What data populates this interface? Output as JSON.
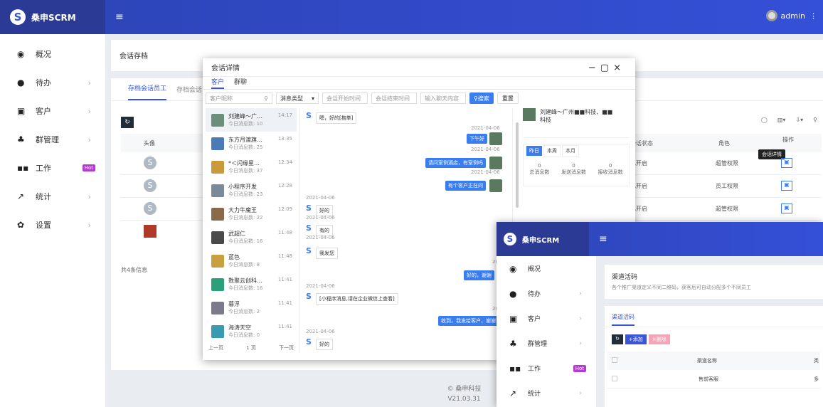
{
  "app": {
    "brand": "桑申SCRM",
    "user": "admin"
  },
  "sidebar": {
    "items": [
      {
        "icon": "dashboard-icon",
        "label": "概况",
        "arrow": ""
      },
      {
        "icon": "clock-icon",
        "label": "待办",
        "arrow": "›"
      },
      {
        "icon": "id-card-icon",
        "label": "客户",
        "arrow": "›"
      },
      {
        "icon": "group-icon",
        "label": "群管理",
        "arrow": "›"
      },
      {
        "icon": "grid-icon",
        "label": "工作",
        "arrow": "",
        "badge": "Hot"
      },
      {
        "icon": "chart-icon",
        "label": "统计",
        "arrow": "›"
      },
      {
        "icon": "gear-icon",
        "label": "设置",
        "arrow": "›"
      }
    ]
  },
  "page": {
    "title": "会话存档",
    "tabs": [
      "存档会话员工",
      "存档会话"
    ],
    "columns": [
      "头像",
      "会话状态",
      "角色",
      "操作"
    ],
    "rows": [
      {
        "status": "已开启",
        "role": "超管权限"
      },
      {
        "status": "已开启",
        "role": "员工权限"
      },
      {
        "status": "已开启",
        "role": "超管权限"
      }
    ],
    "total": "共4条信息",
    "tooltip": "会话详情",
    "footer_line1": "© 桑申科技",
    "footer_line2": "V21.03.31"
  },
  "dialog": {
    "title": "会话详情",
    "tabs": [
      "客户",
      "群聊"
    ],
    "filters": {
      "name_placeholder": "客户昵称",
      "type": "消息类型",
      "start": "会话开始时间",
      "end": "会话结束时间",
      "keyword": "输入聊天内容",
      "search": "搜索",
      "reset": "重置"
    },
    "contacts": [
      {
        "name": "刘建峰～广…",
        "count": "今日消息数: 10",
        "time": "14:17",
        "color": "#6c8e7a"
      },
      {
        "name": "东方月渡旗…",
        "count": "今日消息数: 25",
        "time": "13:35",
        "color": "#4a7ab8"
      },
      {
        "name": "*＜闪缘星…",
        "count": "今日消息数: 37",
        "time": "12:34",
        "color": "#c89a3a"
      },
      {
        "name": "小程序开发",
        "count": "今日消息数: 23",
        "time": "12:28",
        "color": "#7a8a9a"
      },
      {
        "name": "大力牛魔王",
        "count": "今日消息数: 22",
        "time": "12:09",
        "color": "#8a6a4a"
      },
      {
        "name": "武超仁",
        "count": "今日消息数: 16",
        "time": "11:48",
        "color": "#4a4a4a"
      },
      {
        "name": "蓝色",
        "count": "今日消息数: 8",
        "time": "11:48",
        "color": "#c8a040"
      },
      {
        "name": "数聚云创科…",
        "count": "今日消息数: 16",
        "time": "11:41",
        "color": "#2aa07a"
      },
      {
        "name": "暮浮",
        "count": "今日消息数: 2",
        "time": "11:41",
        "color": "#7a7a8a"
      },
      {
        "name": "海涛天空",
        "count": "今日消息数: 0",
        "time": "11:41",
        "color": "#3a9ab0"
      }
    ],
    "pager": {
      "prev": "上一页",
      "page": "1 页",
      "next": "下一页"
    },
    "messages": {
      "m1": "嗯，好的[抱拳]",
      "d1": "2021-04-06",
      "m2": "下午好",
      "d2": "2021-04-06",
      "m3": "请问室例酒店，有室例吗",
      "d3": "2021-04-06",
      "m4": "有个客户正在问",
      "d4": "2021-04-06",
      "m5": "好的",
      "d5": "2021-04-06",
      "m6": "有的",
      "d6": "2021-04-06",
      "m7": "我发您",
      "d7": "2021-",
      "m8": "好的，谢谢",
      "d8": "2021-04-06",
      "m9": "[小程序消息,请在企业微信上查看]",
      "d9": "2021-",
      "m10": "收到，我发给客户，谢谢",
      "d10": "2021-04-06",
      "m11": "好的"
    },
    "right": {
      "name": "刘建峰～广州■■科技、■■科技",
      "tabs": [
        "昨日",
        "本周",
        "本月"
      ],
      "stats": [
        {
          "value": "0",
          "label": "总消息数"
        },
        {
          "value": "0",
          "label": "发送消息数"
        },
        {
          "value": "0",
          "label": "接收消息数"
        }
      ]
    }
  },
  "win2": {
    "brand": "桑申SCRM",
    "card_title": "渠道活码",
    "card_desc": "各个推广渠道定义不同二维码，获客后可自动分配多个不同员工",
    "tab": "渠道活码",
    "add": "+添加",
    "del": "×删除",
    "col_name": "渠道名称",
    "col_type": "类",
    "row1": "售前客服",
    "row1_type": "多"
  }
}
